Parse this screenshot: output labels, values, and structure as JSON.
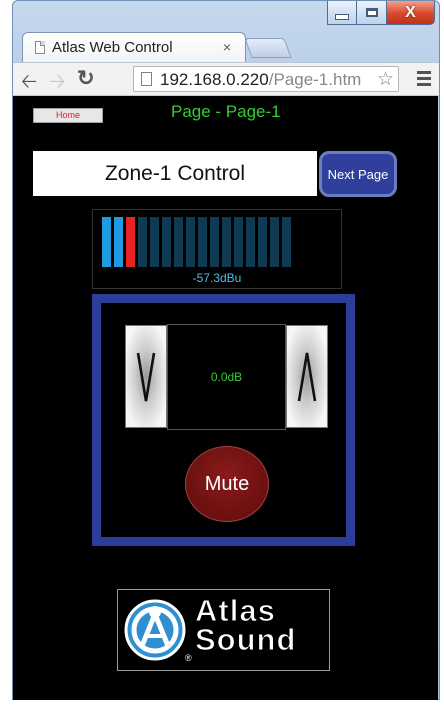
{
  "browser": {
    "tab_title": "Atlas Web Control",
    "tab_close": "×",
    "url_host": "192.168.0.220",
    "url_path": "/Page-1.htm",
    "window_controls": {
      "close_label": "X"
    },
    "icons": [
      "back-arrow-icon",
      "forward-arrow-icon",
      "reload-icon",
      "page-icon",
      "star-icon",
      "menu-icon"
    ]
  },
  "page": {
    "home_button": "Home",
    "title": "Page - Page-1",
    "zone_label": "Zone-1 Control",
    "next_button": "Next Page"
  },
  "meter": {
    "segments_total": 16,
    "segments_lit": 2,
    "peak_segment": 3,
    "value": "-57.3dBu",
    "colors": {
      "lit": "#1e9be1",
      "peak": "#e62222",
      "off": "#0f3a53"
    }
  },
  "volume": {
    "down_symbol": "V",
    "up_symbol": "Λ",
    "level": "0.0dB",
    "mute_label": "Mute",
    "frame_color": "#2c3e99"
  },
  "logo": {
    "line1": "Atlas",
    "line2": "Sound",
    "reg": "®"
  }
}
